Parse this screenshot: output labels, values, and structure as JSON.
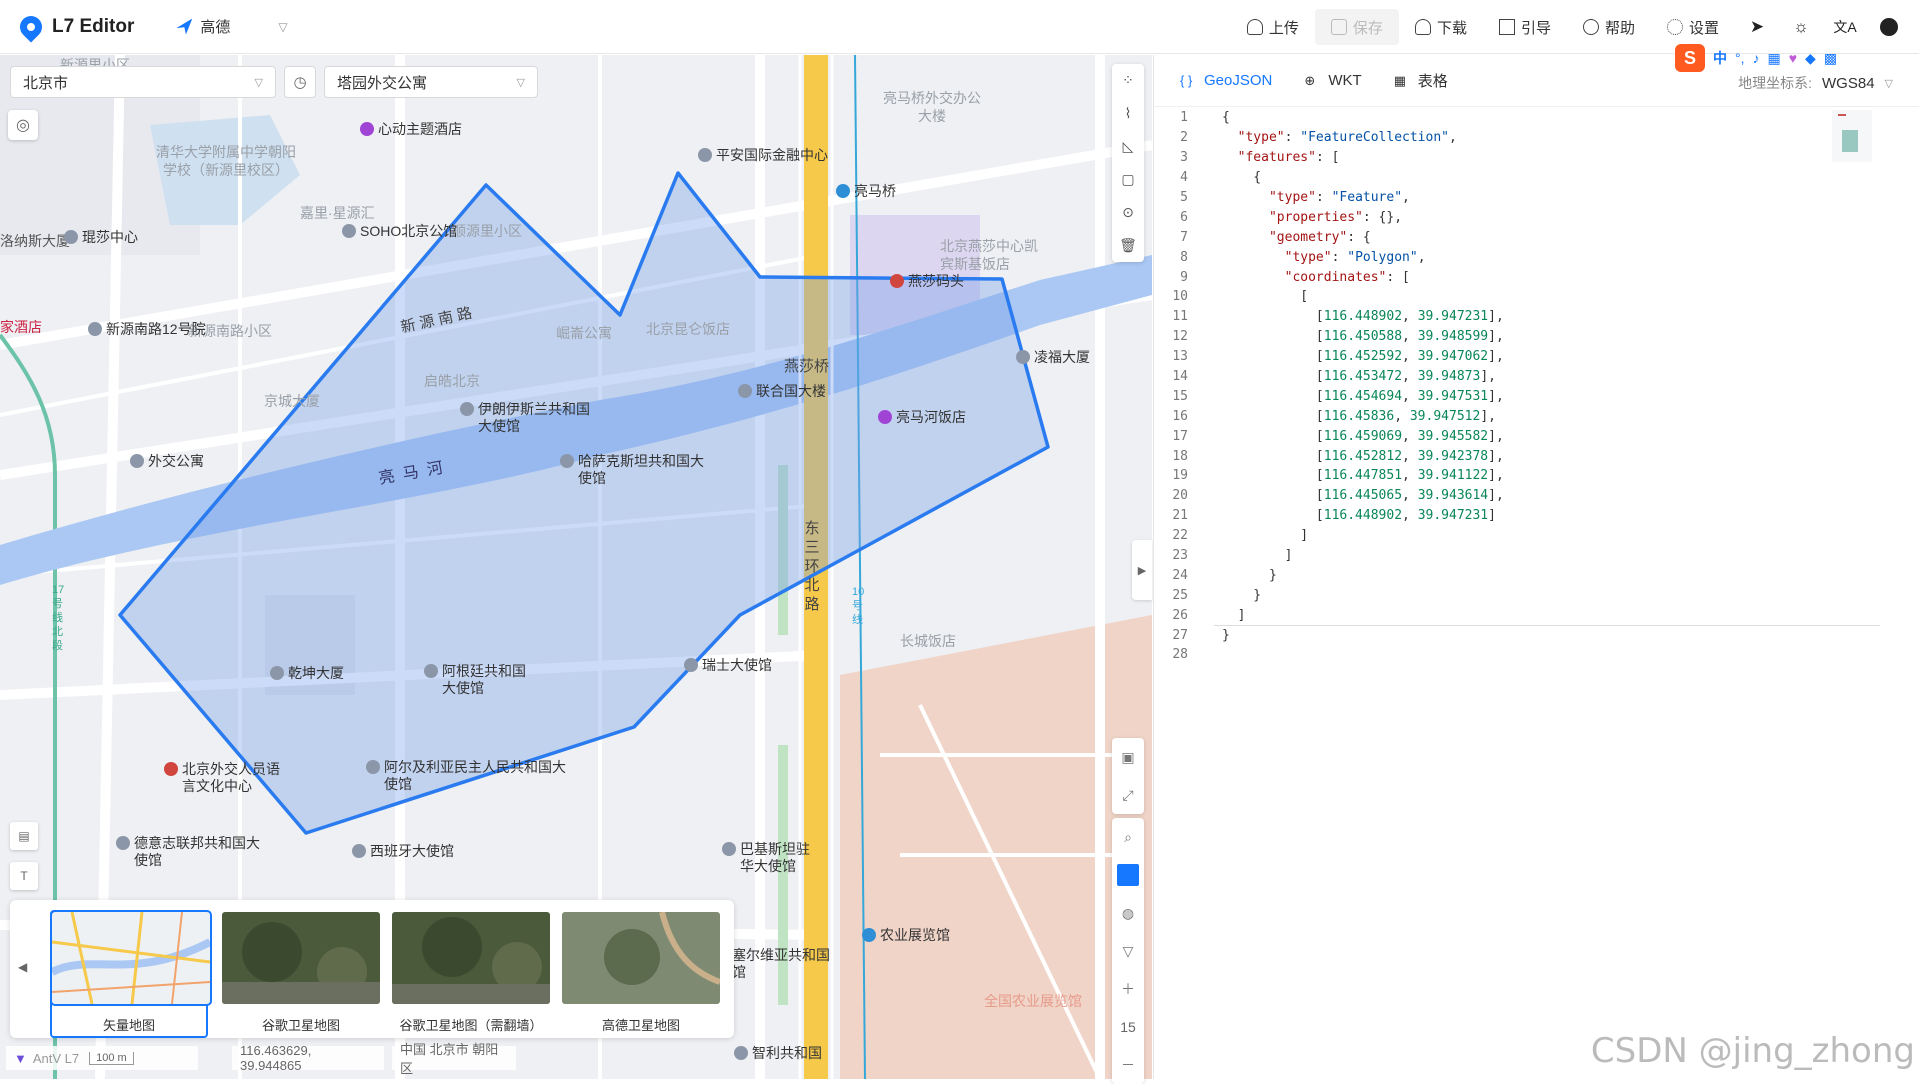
{
  "header": {
    "app_title": "L7 Editor",
    "map_provider": "高德",
    "actions": {
      "upload": "上传",
      "save": "保存",
      "download": "下载",
      "guide": "引导",
      "help": "帮助",
      "settings": "设置"
    }
  },
  "map": {
    "city_select": "北京市",
    "search_value": "塔园外交公寓",
    "zoom_level": "15",
    "cursor_coords": "116.463629, 39.944865",
    "region": "中国 北京市 朝阳区",
    "scale": "100 m",
    "logo_text": "AntV L7",
    "labels": {
      "river": "亮 马 河",
      "road_xinyuan": "新 源 南 路",
      "yansha_bridge": "燕莎桥",
      "liangma_bridge": "亮马桥",
      "east3": "东三环北路",
      "line10": "10号线",
      "line17": "17号线北段",
      "changcheng": "长城饭店",
      "nongye": "全国农业展览馆",
      "tsinghua": "清华大学附属中学朝阳学校（新源里校区）",
      "jiali": "嘉里·星源汇",
      "shunyuan": "顺源里小区",
      "xinyuannan": "新源南路小区",
      "qihao": "启皓北京",
      "jingcheng": "京城大厦",
      "kunlun": "北京昆仑饭店",
      "zhuolun": "崛崙公寓",
      "liangmawaijiao": "亮马桥外交办公大楼",
      "kempinski": "北京燕莎中心凯宾斯基饭店",
      "xinyuanli_top": "新源里小区",
      "lnas": "洛纳斯大厦",
      "jiudian": "家酒店"
    },
    "pois": {
      "xindong": "心动主题酒店",
      "pingan": "平安国际金融中心",
      "liangmaqiao": "亮马桥",
      "soho": "SOHO北京公馆",
      "lisha": "琨莎中心",
      "yanshamatou": "燕莎码头",
      "lianhe": "联合国大楼",
      "lingfu": "凌福大厦",
      "liangmahe_hotel": "亮马河饭店",
      "xinyuan12": "新源南路12号院",
      "iran": "伊朗伊斯兰共和国大使馆",
      "kazakh": "哈萨克斯坦共和国大使馆",
      "waijiao": "外交公寓",
      "swiss": "瑞士大使馆",
      "qiankun": "乾坤大厦",
      "argentina": "阿根廷共和国大使馆",
      "algeria": "阿尔及利亚民主人民共和国大使馆",
      "waijiaorenyuan": "北京外交人员语言文化中心",
      "germany": "德意志联邦共和国大使馆",
      "spain": "西班牙大使馆",
      "brazil": "巴基斯坦驻华大使馆",
      "nongyezhanlan": "农业展览馆",
      "chile": "智利共和国",
      "serbia": "塞尔维亚共和国馆"
    },
    "layers": [
      {
        "name": "矢量地图"
      },
      {
        "name": "谷歌卫星地图"
      },
      {
        "name": "谷歌卫星地图（需翻墙）"
      },
      {
        "name": "高德卫星地图"
      }
    ],
    "colors": {
      "polygon_stroke": "#2a7bf0",
      "polygon_fill": "#b9cff5",
      "river": "#aac8f3",
      "road_yellow": "#f6c94a"
    }
  },
  "panel": {
    "tabs": [
      "GeoJSON",
      "WKT",
      "表格"
    ],
    "crs_label": "地理坐标系:",
    "crs_value": "WGS84",
    "code_lines": [
      "{",
      "  \"type\": \"FeatureCollection\",",
      "  \"features\": [",
      "    {",
      "      \"type\": \"Feature\",",
      "      \"properties\": {},",
      "      \"geometry\": {",
      "        \"type\": \"Polygon\",",
      "        \"coordinates\": [",
      "          [",
      "            [116.448902, 39.947231],",
      "            [116.450588, 39.948599],",
      "            [116.452592, 39.947062],",
      "            [116.453472, 39.94873],",
      "            [116.454694, 39.947531],",
      "            [116.45836, 39.947512],",
      "            [116.459069, 39.945582],",
      "            [116.452812, 39.942378],",
      "            [116.447851, 39.941122],",
      "            [116.445065, 39.943614],",
      "            [116.448902, 39.947231]",
      "          ]",
      "        ]",
      "      }",
      "    }",
      "  ]",
      "}",
      ""
    ]
  },
  "ime": {
    "logo": "S",
    "mode": "中"
  },
  "watermark": "CSDN @jing_zhong"
}
